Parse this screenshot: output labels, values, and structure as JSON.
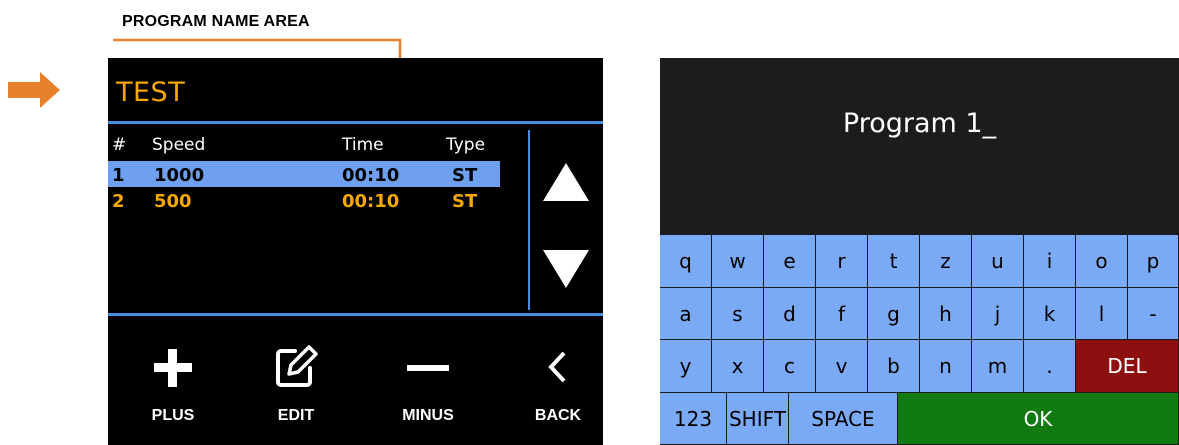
{
  "annotation": {
    "label": "PROGRAM NAME AREA",
    "accent_color": "#e8812c"
  },
  "program_screen": {
    "program_name": "TEST",
    "columns": [
      "#",
      "Speed",
      "Time",
      "Type"
    ],
    "rows": [
      {
        "num": "1",
        "speed": "1000",
        "time": "00:10",
        "type": "ST",
        "selected": true
      },
      {
        "num": "2",
        "speed": "500",
        "time": "00:10",
        "type": "ST",
        "selected": false
      }
    ],
    "scroll_up_icon": "triangle-up-icon",
    "scroll_down_icon": "triangle-down-icon",
    "toolbar": {
      "plus_label": "PLUS",
      "edit_label": "EDIT",
      "minus_label": "MINUS",
      "back_label": "BACK"
    },
    "colors": {
      "name_color": "#f5a800",
      "row_color": "#f5a800",
      "selected_bg": "#6fa0f0",
      "divider": "#4a8be0"
    }
  },
  "keyboard_screen": {
    "input_value": "Program 1_",
    "rows": [
      [
        "q",
        "w",
        "e",
        "r",
        "t",
        "z",
        "u",
        "i",
        "o",
        "p"
      ],
      [
        "a",
        "s",
        "d",
        "f",
        "g",
        "h",
        "j",
        "k",
        "l",
        "-"
      ],
      [
        "y",
        "x",
        "c",
        "v",
        "b",
        "n",
        "m",
        ".",
        "DEL"
      ],
      [
        "123",
        "SHIFT",
        "SPACE",
        "OK"
      ]
    ],
    "colors": {
      "key_bg": "#7aaaf5",
      "del_bg": "#8c1010",
      "ok_bg": "#117a11"
    }
  }
}
